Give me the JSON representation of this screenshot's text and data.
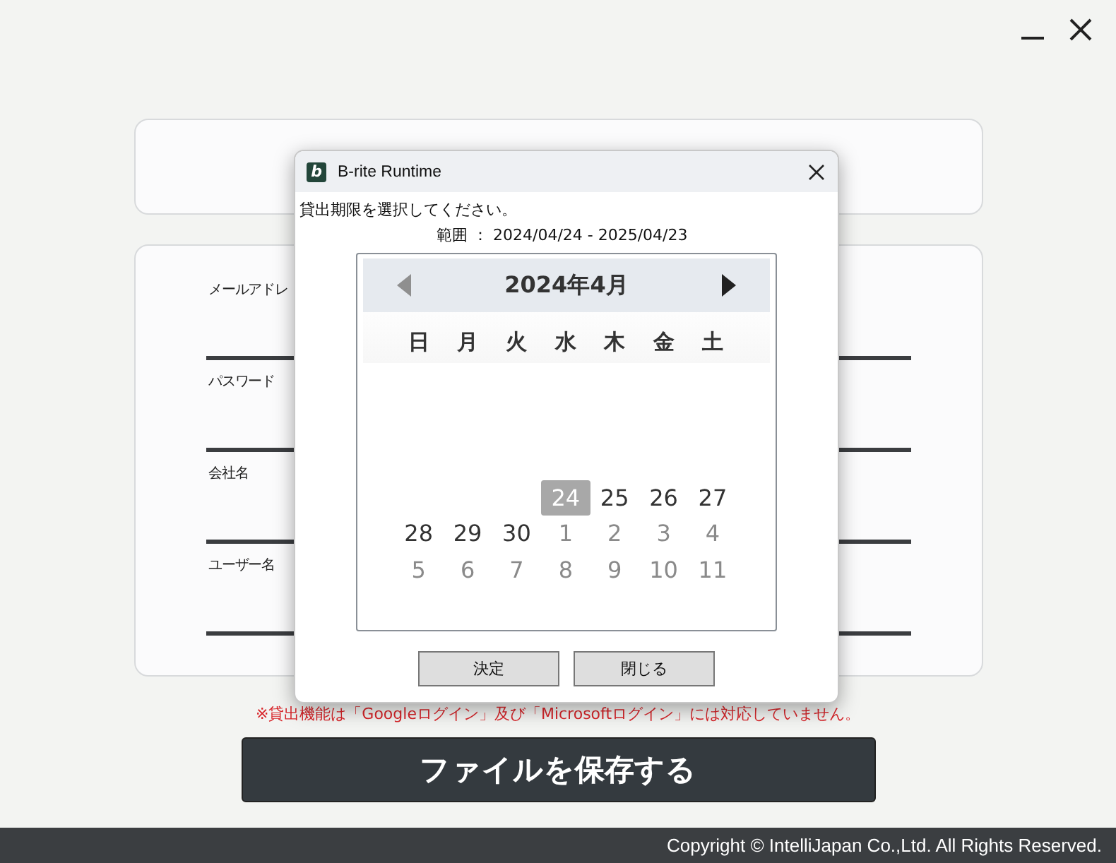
{
  "window_controls": [
    {
      "kind": "minimize"
    },
    {
      "kind": "close"
    }
  ],
  "form": {
    "fields": [
      {
        "label": "メールアドレ"
      },
      {
        "label": "パスワード"
      },
      {
        "label": "会社名"
      },
      {
        "label": "ユーザー名"
      }
    ]
  },
  "notice": "※貸出機能は「Googleログイン」及び「Microsoftログイン」には対応していません。",
  "save_button": "ファイルを保存する",
  "footer": "Copyright ©  IntelliJapan Co.,Ltd.  All Rights Reserved.",
  "dialog": {
    "title": "B-rite Runtime",
    "logo": "b",
    "prompt": "貸出期限を選択してください。",
    "range": "範囲 ： 2024/04/24  -  2025/04/23",
    "calendar": {
      "month": "2024年4月",
      "prev_disabled": true,
      "next_disabled": false,
      "weekdays": [
        "日",
        "月",
        "火",
        "水",
        "木",
        "金",
        "土"
      ],
      "weeks": [
        [
          {
            "kind": "blank"
          },
          {
            "kind": "blank"
          },
          {
            "kind": "blank"
          },
          {
            "kind": "current",
            "label": "24",
            "selected": true
          },
          {
            "kind": "current",
            "label": "25",
            "selected": false
          },
          {
            "kind": "current",
            "label": "26",
            "selected": false
          },
          {
            "kind": "current",
            "label": "27",
            "selected": false
          }
        ],
        [
          {
            "kind": "current",
            "label": "28",
            "selected": false
          },
          {
            "kind": "current",
            "label": "29",
            "selected": false
          },
          {
            "kind": "current",
            "label": "30",
            "selected": false
          },
          {
            "kind": "other",
            "label": "1",
            "selected": false
          },
          {
            "kind": "other",
            "label": "2",
            "selected": false
          },
          {
            "kind": "other",
            "label": "3",
            "selected": false
          },
          {
            "kind": "other",
            "label": "4",
            "selected": false
          }
        ],
        [
          {
            "kind": "other",
            "label": "5",
            "selected": false
          },
          {
            "kind": "other",
            "label": "6",
            "selected": false
          },
          {
            "kind": "other",
            "label": "7",
            "selected": false
          },
          {
            "kind": "other",
            "label": "8",
            "selected": false
          },
          {
            "kind": "other",
            "label": "9",
            "selected": false
          },
          {
            "kind": "other",
            "label": "10",
            "selected": false
          },
          {
            "kind": "other",
            "label": "11",
            "selected": false
          }
        ]
      ]
    },
    "buttons": [
      "決定",
      "閉じる"
    ]
  }
}
